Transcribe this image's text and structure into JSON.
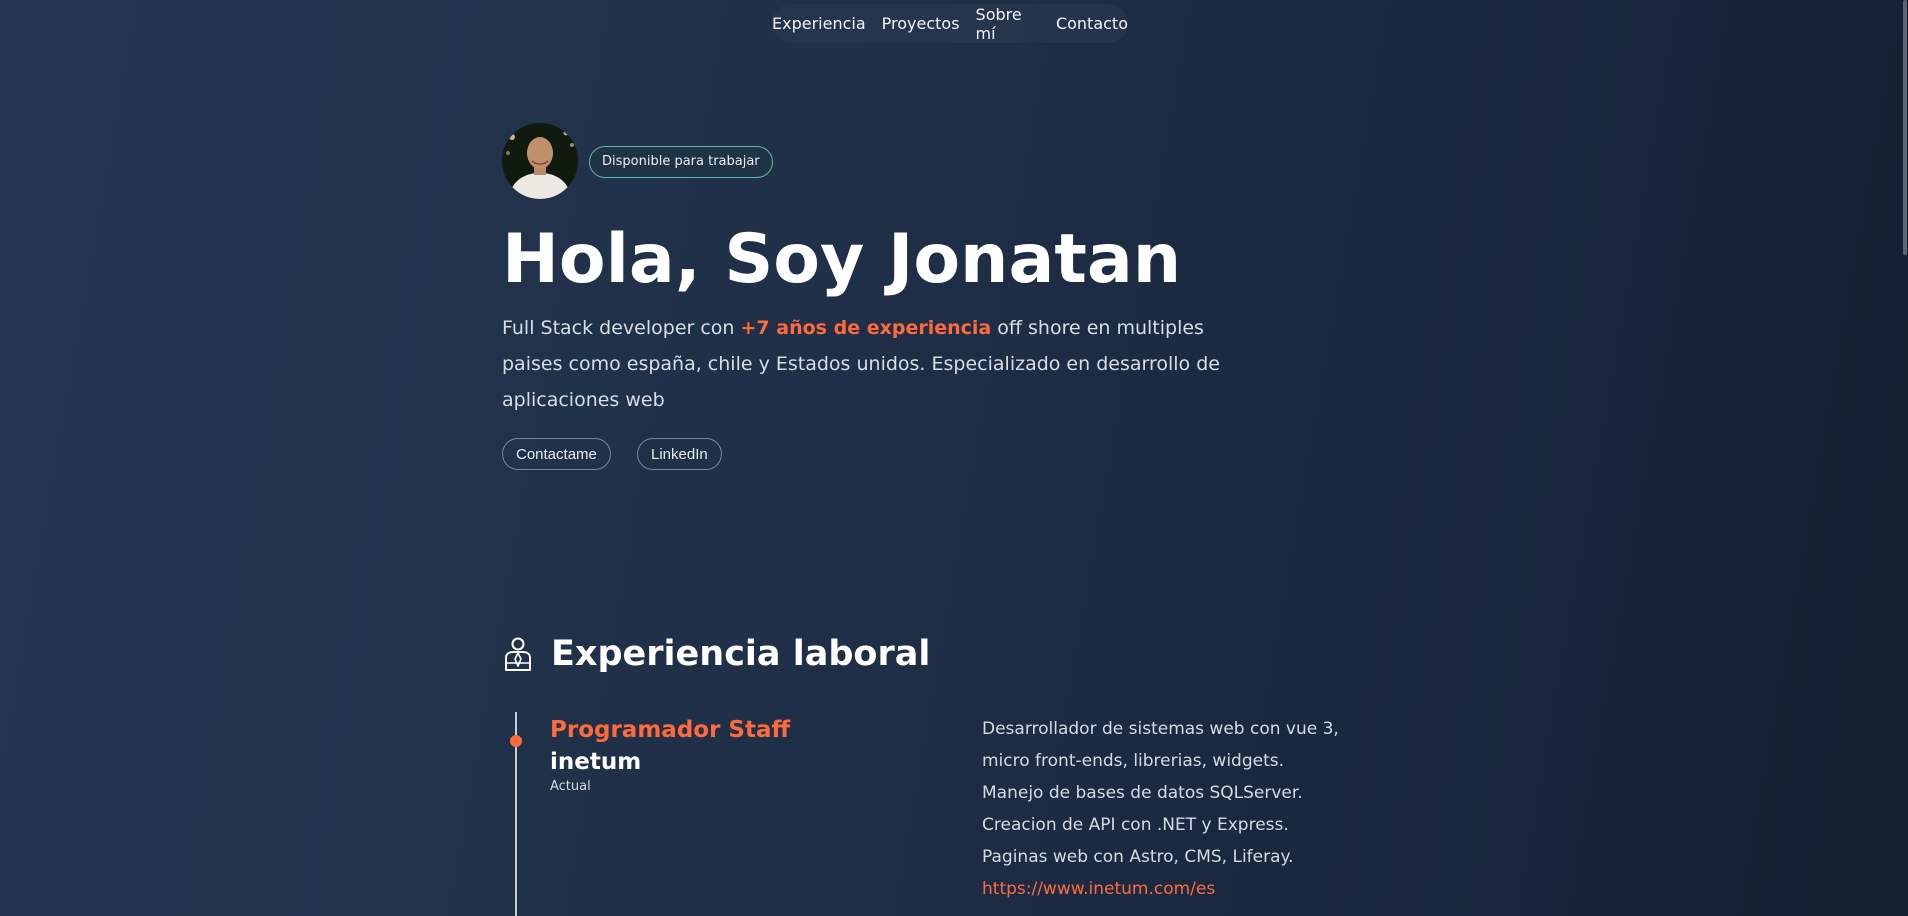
{
  "nav": {
    "items": [
      {
        "label": "Experiencia"
      },
      {
        "label": "Proyectos"
      },
      {
        "label": "Sobre mí"
      },
      {
        "label": "Contacto"
      }
    ]
  },
  "hero": {
    "badge": "Disponible para trabajar",
    "title": "Hola, Soy Jonatan",
    "description": {
      "before": "Full Stack developer con ",
      "highlight": "+7 años de experiencia",
      "after": " off shore en multiples paises como españa, chile y Estados unidos. Especializado en desarrollo de aplicaciones web"
    },
    "buttons": {
      "contact": "Contactame",
      "linkedin": "LinkedIn"
    }
  },
  "experience": {
    "title": "Experiencia laboral",
    "jobs": [
      {
        "role": "Programador Staff",
        "company": "inetum",
        "period": "Actual",
        "description_lines": [
          "Desarrollador de sistemas web con vue 3,",
          "micro front-ends, librerias, widgets.",
          "Manejo de bases de datos SQLServer.",
          "Creacion de API con .NET y Express.",
          "Paginas web con Astro, CMS, Liferay."
        ],
        "link": "https://www.inetum.com/es"
      }
    ]
  },
  "colors": {
    "accent": "#ff6a3d",
    "badge_border": "#5fb3a7",
    "background_start": "#243650",
    "background_end": "#141f31"
  }
}
